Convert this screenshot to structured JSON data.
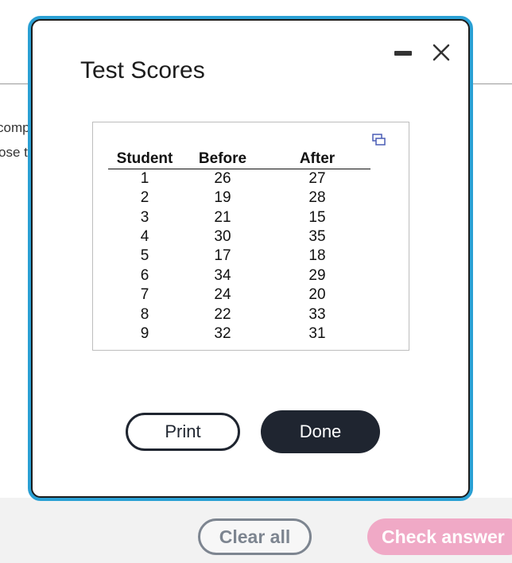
{
  "background": {
    "fragment_1": "comp",
    "fragment_2": "ose t"
  },
  "dialog": {
    "title": "Test Scores",
    "table": {
      "headers": [
        "Student",
        "Before",
        "After"
      ],
      "rows": [
        [
          "1",
          "26",
          "27"
        ],
        [
          "2",
          "19",
          "28"
        ],
        [
          "3",
          "21",
          "15"
        ],
        [
          "4",
          "30",
          "35"
        ],
        [
          "5",
          "17",
          "18"
        ],
        [
          "6",
          "34",
          "29"
        ],
        [
          "7",
          "24",
          "20"
        ],
        [
          "8",
          "22",
          "33"
        ],
        [
          "9",
          "32",
          "31"
        ]
      ]
    },
    "print_label": "Print",
    "done_label": "Done"
  },
  "footer": {
    "clear_label": "Clear all",
    "check_label": "Check answer"
  },
  "colors": {
    "dialog_border": "#2aa0d4",
    "primary_button": "#1f2530",
    "check_button": "#f0a9c6"
  },
  "icons": [
    "minimize-icon",
    "close-icon",
    "expand-icon"
  ]
}
